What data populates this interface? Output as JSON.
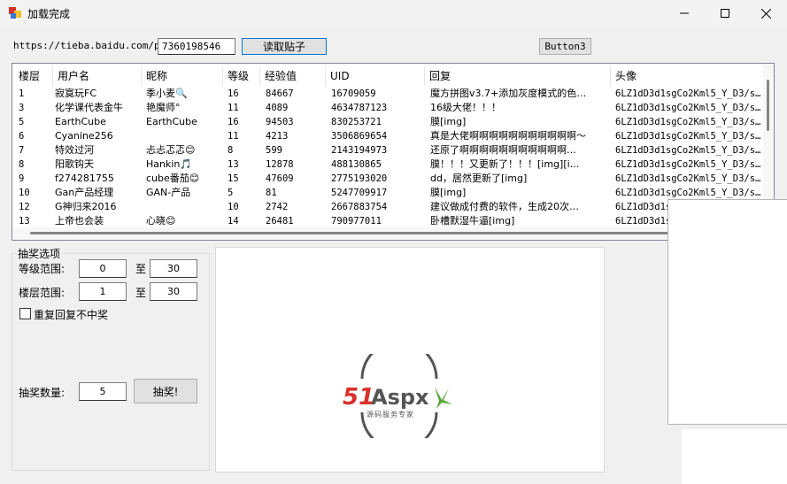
{
  "window": {
    "title": "加载完成"
  },
  "toolbar": {
    "url_prefix": "https://tieba.baidu.com/p/",
    "post_id": "7360198546",
    "load_button": "读取贴子",
    "button3": "Button3"
  },
  "table": {
    "columns": [
      "楼层",
      "用户名",
      "昵称",
      "等级",
      "经验值",
      "UID",
      "回复",
      "头像"
    ],
    "rows": [
      [
        "1",
        "寂寞玩FC",
        "季小麦🔍",
        "16",
        "84667",
        "16709059",
        "魔方拼图v3.7+添加灰度模式的色…",
        "6LZ1dD3d1sgCo2Kml5_Y_D3/s…"
      ],
      [
        "3",
        "化学课代表金牛",
        "艳魔师°",
        "11",
        "4089",
        "4634787123",
        "16级大佬！！！",
        "6LZ1dD3d1sgCo2Kml5_Y_D3/s…"
      ],
      [
        "5",
        "EarthCube",
        "EarthCube",
        "16",
        "94503",
        "830253721",
        "膜[img]",
        "6LZ1dD3d1sgCo2Kml5_Y_D3/s…"
      ],
      [
        "6",
        "Cyanine256",
        "",
        "11",
        "4213",
        "3506869654",
        "真是大佬啊啊啊啊啊啊啊啊啊啊啊～",
        "6LZ1dD3d1sgCo2Kml5_Y_D3/s…"
      ],
      [
        "7",
        "特效过河",
        "忐忐忑忑😊",
        "8",
        "599",
        "2143194973",
        "还原了啊啊啊啊啊啊啊啊啊啊啊…",
        "6LZ1dD3d1sgCo2Kml5_Y_D3/s…"
      ],
      [
        "8",
        "阳歌钩天",
        "Hankin🎵",
        "13",
        "12878",
        "488130865",
        "膜！！！又更新了！！！[img][i…",
        "6LZ1dD3d1sgCo2Kml5_Y_D3/s…"
      ],
      [
        "9",
        "f274281755",
        "cube番茄😊",
        "15",
        "47609",
        "2775193020",
        "dd，居然更新了[img]",
        "6LZ1dD3d1sgCo2Kml5_Y_D3/s…"
      ],
      [
        "10",
        "Gan产品经理",
        "GAN-产品",
        "5",
        "81",
        "5247709917",
        "膜[img]",
        "6LZ1dD3d1sgCo2Kml5_Y_D3/s…"
      ],
      [
        "12",
        "G神归来2016",
        "",
        "10",
        "2742",
        "2667883754",
        "建议做成付费的软件，生成20次…",
        "6LZ1dD3d1sgCo2Kml5_Y_D3/s…"
      ],
      [
        "13",
        "上帝也会装",
        "心晓😊",
        "14",
        "26481",
        "790977011",
        "卧槽默湿牛逼[img]",
        "6LZ1dD3d1sgCo2Kml5_Y_D3/s…"
      ]
    ]
  },
  "lottery": {
    "group_title": "抽奖选项",
    "level_label": "等级范围:",
    "level_min": "0",
    "level_max": "30",
    "floor_label": "楼层范围:",
    "floor_min": "1",
    "floor_max": "30",
    "to": "至",
    "no_repeat_label": "重复回复不中奖",
    "count_label": "抽奖数量:",
    "count": "5",
    "draw_button": "抽奖!"
  },
  "logo": {
    "brand": "51Aspx",
    "tagline": "源码服务专家"
  },
  "colors": {
    "logo_red": "#d9302b",
    "logo_green": "#5aa53a",
    "focus_blue": "#0078d7"
  }
}
